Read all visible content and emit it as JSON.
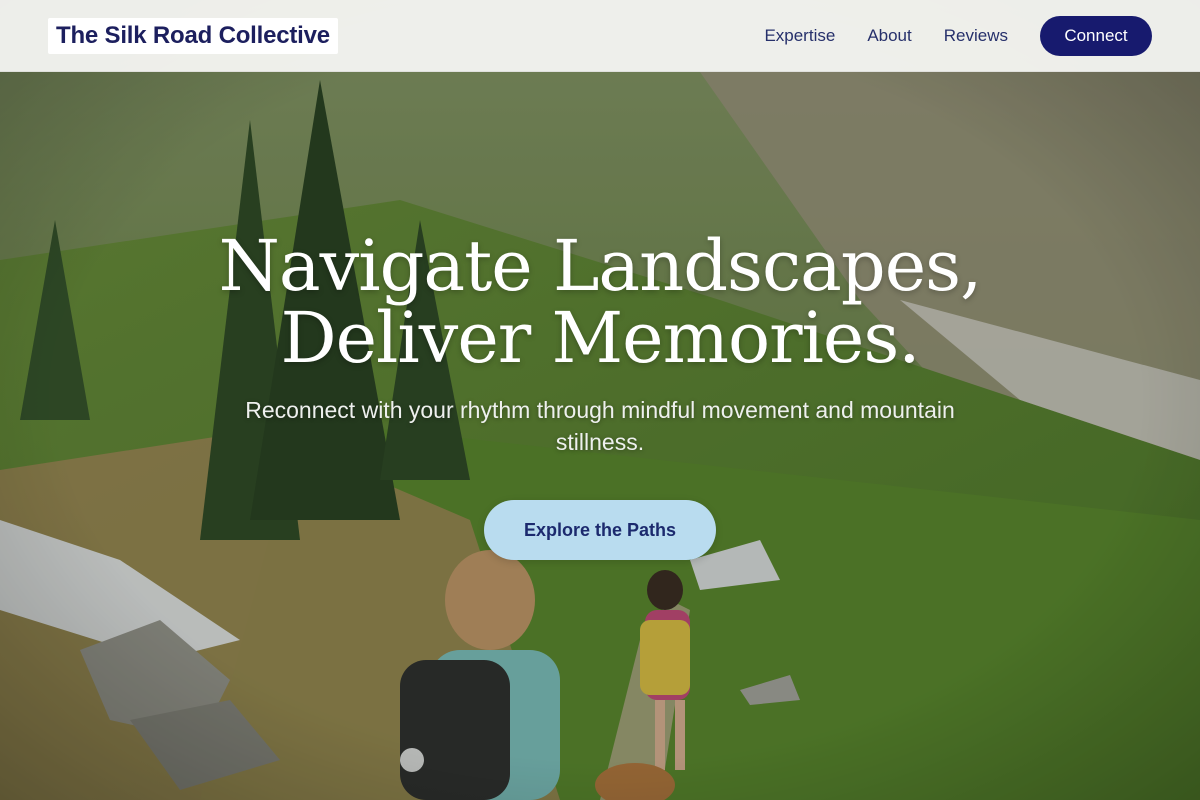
{
  "brand": {
    "name": "The Silk Road Collective"
  },
  "nav": {
    "items": [
      {
        "label": "Expertise"
      },
      {
        "label": "About"
      },
      {
        "label": "Reviews"
      }
    ],
    "connect_label": "Connect"
  },
  "hero": {
    "headline_line1": "Navigate Landscapes,",
    "headline_line2": "Deliver Memories.",
    "subtitle": "Reconnect with your rhythm through mindful movement and mountain stillness.",
    "cta_label": "Explore the Paths",
    "background": "mountain-hikers-photo"
  },
  "colors": {
    "brand_navy": "#171a6e",
    "cta_light_blue": "#b9dcef",
    "nav_background": "#f6f6f4",
    "logo_text": "#1c1f5e"
  }
}
